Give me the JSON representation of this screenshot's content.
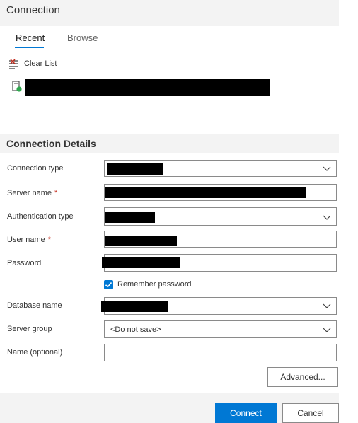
{
  "dialog": {
    "title": "Connection"
  },
  "tabs": [
    {
      "label": "Recent",
      "active": true
    },
    {
      "label": "Browse",
      "active": false
    }
  ],
  "recent": {
    "clear_label": "Clear List",
    "clear_icon": "clear-list-icon",
    "server_icon": "server-connected-icon"
  },
  "details": {
    "title": "Connection Details",
    "fields": {
      "connection_type": {
        "label": "Connection type"
      },
      "server_name": {
        "label": "Server name",
        "required_mark": "*"
      },
      "authentication_type": {
        "label": "Authentication type"
      },
      "user_name": {
        "label": "User name",
        "required_mark": "*"
      },
      "password": {
        "label": "Password"
      },
      "remember_password": {
        "label": "Remember password",
        "checked": true
      },
      "database_name": {
        "label": "Database name"
      },
      "server_group": {
        "label": "Server group",
        "value": "<Do not save>"
      },
      "name_optional": {
        "label": "Name (optional)",
        "value": ""
      }
    },
    "advanced_label": "Advanced..."
  },
  "footer": {
    "connect_label": "Connect",
    "cancel_label": "Cancel"
  },
  "colors": {
    "accent": "#0078d4",
    "band": "#f3f3f3",
    "required": "#c42b1c"
  }
}
